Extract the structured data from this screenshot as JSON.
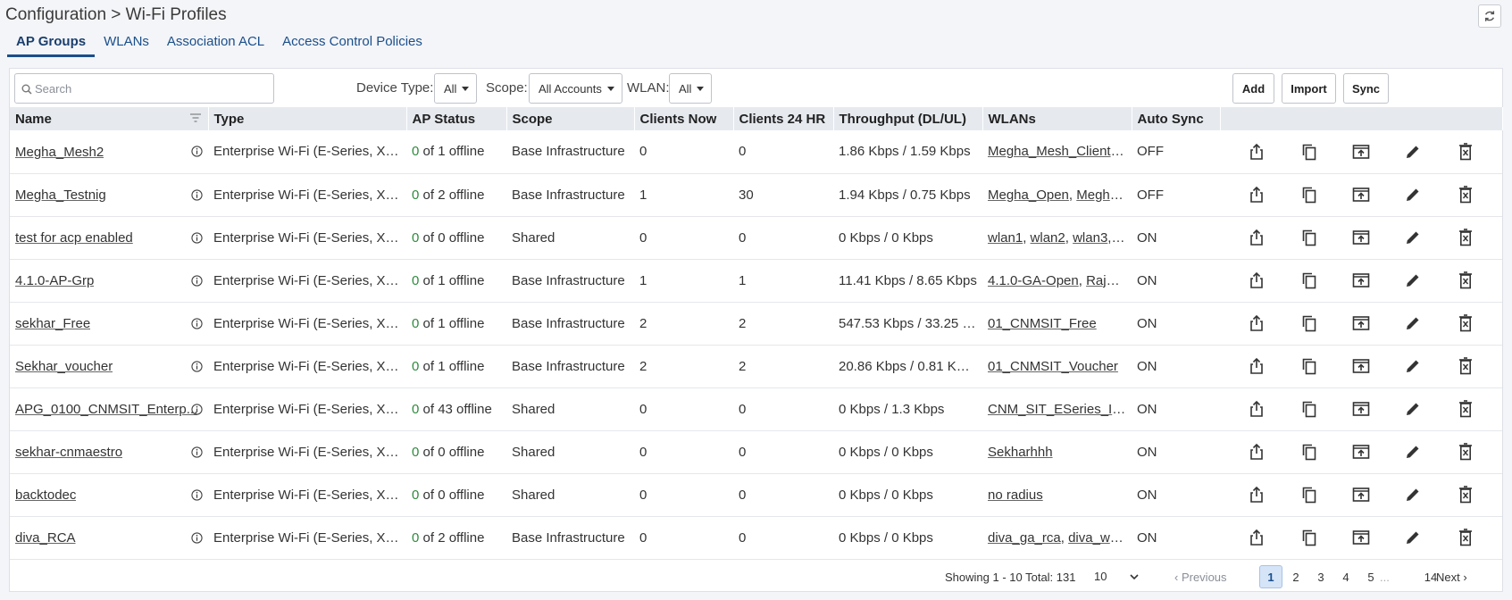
{
  "header": {
    "title": "Configuration > Wi-Fi Profiles",
    "tabs": [
      {
        "label": "AP Groups",
        "active": true
      },
      {
        "label": "WLANs",
        "active": false
      },
      {
        "label": "Association ACL",
        "active": false
      },
      {
        "label": "Access Control Policies",
        "active": false
      }
    ]
  },
  "toolbar": {
    "search_placeholder": "Search",
    "device_type_label": "Device Type:",
    "device_type_value": "All",
    "scope_label": "Scope:",
    "scope_value": "All Accounts",
    "wlan_label": "WLAN:",
    "wlan_value": "All",
    "add_label": "Add",
    "import_label": "Import",
    "sync_label": "Sync"
  },
  "table": {
    "columns": [
      "Name",
      "Type",
      "AP Status",
      "Scope",
      "Clients Now",
      "Clients 24 HR",
      "Throughput (DL/UL)",
      "WLANs",
      "Auto Sync"
    ],
    "rows": [
      {
        "name": "Megha_Mesh2",
        "type": "Enterprise Wi-Fi (E-Series, XE/X...",
        "ap_online": "0",
        "ap_rest": " of 1 offline",
        "scope": "Base Infrastructure",
        "clients_now": "0",
        "clients_24": "0",
        "throughput": "1.86 Kbps / 1.59 Kbps",
        "wlans": [
          {
            "t": "Megha_Mesh_ClientA...",
            "l": true
          }
        ],
        "auto_sync": "OFF"
      },
      {
        "name": "Megha_Testnig",
        "type": "Enterprise Wi-Fi (E-Series, XE/X...",
        "ap_online": "0",
        "ap_rest": " of 2 offline",
        "scope": "Base Infrastructure",
        "clients_now": "1",
        "clients_24": "30",
        "throughput": "1.94 Kbps / 0.75 Kbps",
        "wlans": [
          {
            "t": "Megha_Open",
            "l": true
          },
          {
            "t": ", ",
            "l": false
          },
          {
            "t": "Megha...",
            "l": true
          }
        ],
        "auto_sync": "OFF"
      },
      {
        "name": "test for acp enabled",
        "type": "Enterprise Wi-Fi (E-Series, XE/X...",
        "ap_online": "0",
        "ap_rest": " of 0 offline",
        "scope": "Shared",
        "clients_now": "0",
        "clients_24": "0",
        "throughput": "0 Kbps / 0 Kbps",
        "wlans": [
          {
            "t": "wlan1",
            "l": true
          },
          {
            "t": ", ",
            "l": false
          },
          {
            "t": "wlan2",
            "l": true
          },
          {
            "t": ", ",
            "l": false
          },
          {
            "t": "wlan3",
            "l": true
          },
          {
            "t": ", ...",
            "l": false
          }
        ],
        "auto_sync": "ON"
      },
      {
        "name": "4.1.0-AP-Grp",
        "type": "Enterprise Wi-Fi (E-Series, XE/X...",
        "ap_online": "0",
        "ap_rest": " of 1 offline",
        "scope": "Base Infrastructure",
        "clients_now": "1",
        "clients_24": "1",
        "throughput": "11.41 Kbps / 8.65 Kbps",
        "wlans": [
          {
            "t": "4.1.0-GA-Open",
            "l": true
          },
          {
            "t": ", ",
            "l": false
          },
          {
            "t": "Raja-e...",
            "l": true
          }
        ],
        "auto_sync": "ON"
      },
      {
        "name": "sekhar_Free",
        "type": "Enterprise Wi-Fi (E-Series, XE/X...",
        "ap_online": "0",
        "ap_rest": " of 1 offline",
        "scope": "Base Infrastructure",
        "clients_now": "2",
        "clients_24": "2",
        "throughput": "547.53 Kbps / 33.25 K...",
        "wlans": [
          {
            "t": "01_CNMSIT_Free",
            "l": true
          }
        ],
        "auto_sync": "ON"
      },
      {
        "name": "Sekhar_voucher",
        "type": "Enterprise Wi-Fi (E-Series, XE/X...",
        "ap_online": "0",
        "ap_rest": " of 1 offline",
        "scope": "Base Infrastructure",
        "clients_now": "2",
        "clients_24": "2",
        "throughput": "20.86 Kbps / 0.81 Kbps",
        "wlans": [
          {
            "t": "01_CNMSIT_Voucher",
            "l": true
          }
        ],
        "auto_sync": "ON"
      },
      {
        "name": "APG_0100_CNMSIT_Enterp...",
        "type": "Enterprise Wi-Fi (E-Series, XE/X...",
        "ap_online": "0",
        "ap_rest": " of 43 offline",
        "scope": "Shared",
        "clients_now": "0",
        "clients_24": "0",
        "throughput": "0 Kbps / 1.3 Kbps",
        "wlans": [
          {
            "t": "CNM_SIT_ESeries_Infi...",
            "l": true
          }
        ],
        "auto_sync": "ON"
      },
      {
        "name": "sekhar-cnmaestro",
        "type": "Enterprise Wi-Fi (E-Series, XE/X...",
        "ap_online": "0",
        "ap_rest": " of 0 offline",
        "scope": "Shared",
        "clients_now": "0",
        "clients_24": "0",
        "throughput": "0 Kbps / 0 Kbps",
        "wlans": [
          {
            "t": "Sekharhhh",
            "l": true
          }
        ],
        "auto_sync": "ON"
      },
      {
        "name": "backtodec",
        "type": "Enterprise Wi-Fi (E-Series, XE/X...",
        "ap_online": "0",
        "ap_rest": " of 0 offline",
        "scope": "Shared",
        "clients_now": "0",
        "clients_24": "0",
        "throughput": "0 Kbps / 0 Kbps",
        "wlans": [
          {
            "t": "no radius",
            "l": true
          }
        ],
        "auto_sync": "ON"
      },
      {
        "name": "diva_RCA",
        "type": "Enterprise Wi-Fi (E-Series, XE/X...",
        "ap_online": "0",
        "ap_rest": " of 2 offline",
        "scope": "Base Infrastructure",
        "clients_now": "0",
        "clients_24": "0",
        "throughput": "0 Kbps / 0 Kbps",
        "wlans": [
          {
            "t": "diva_ga_rca",
            "l": true
          },
          {
            "t": ", ",
            "l": false
          },
          {
            "t": "diva_wp...",
            "l": true
          }
        ],
        "auto_sync": "ON"
      }
    ]
  },
  "pagination": {
    "showing": "Showing 1 - 10 Total: 131",
    "page_size": "10",
    "previous": "Previous",
    "pages": [
      "1",
      "2",
      "3",
      "4",
      "5"
    ],
    "ellipsis": "...",
    "last_page": "14",
    "next": "Next",
    "current": "1"
  },
  "colors": {
    "accent": "#1a4f8b",
    "online_green": "#2e8b3e",
    "header_bg": "#e6eaef"
  }
}
